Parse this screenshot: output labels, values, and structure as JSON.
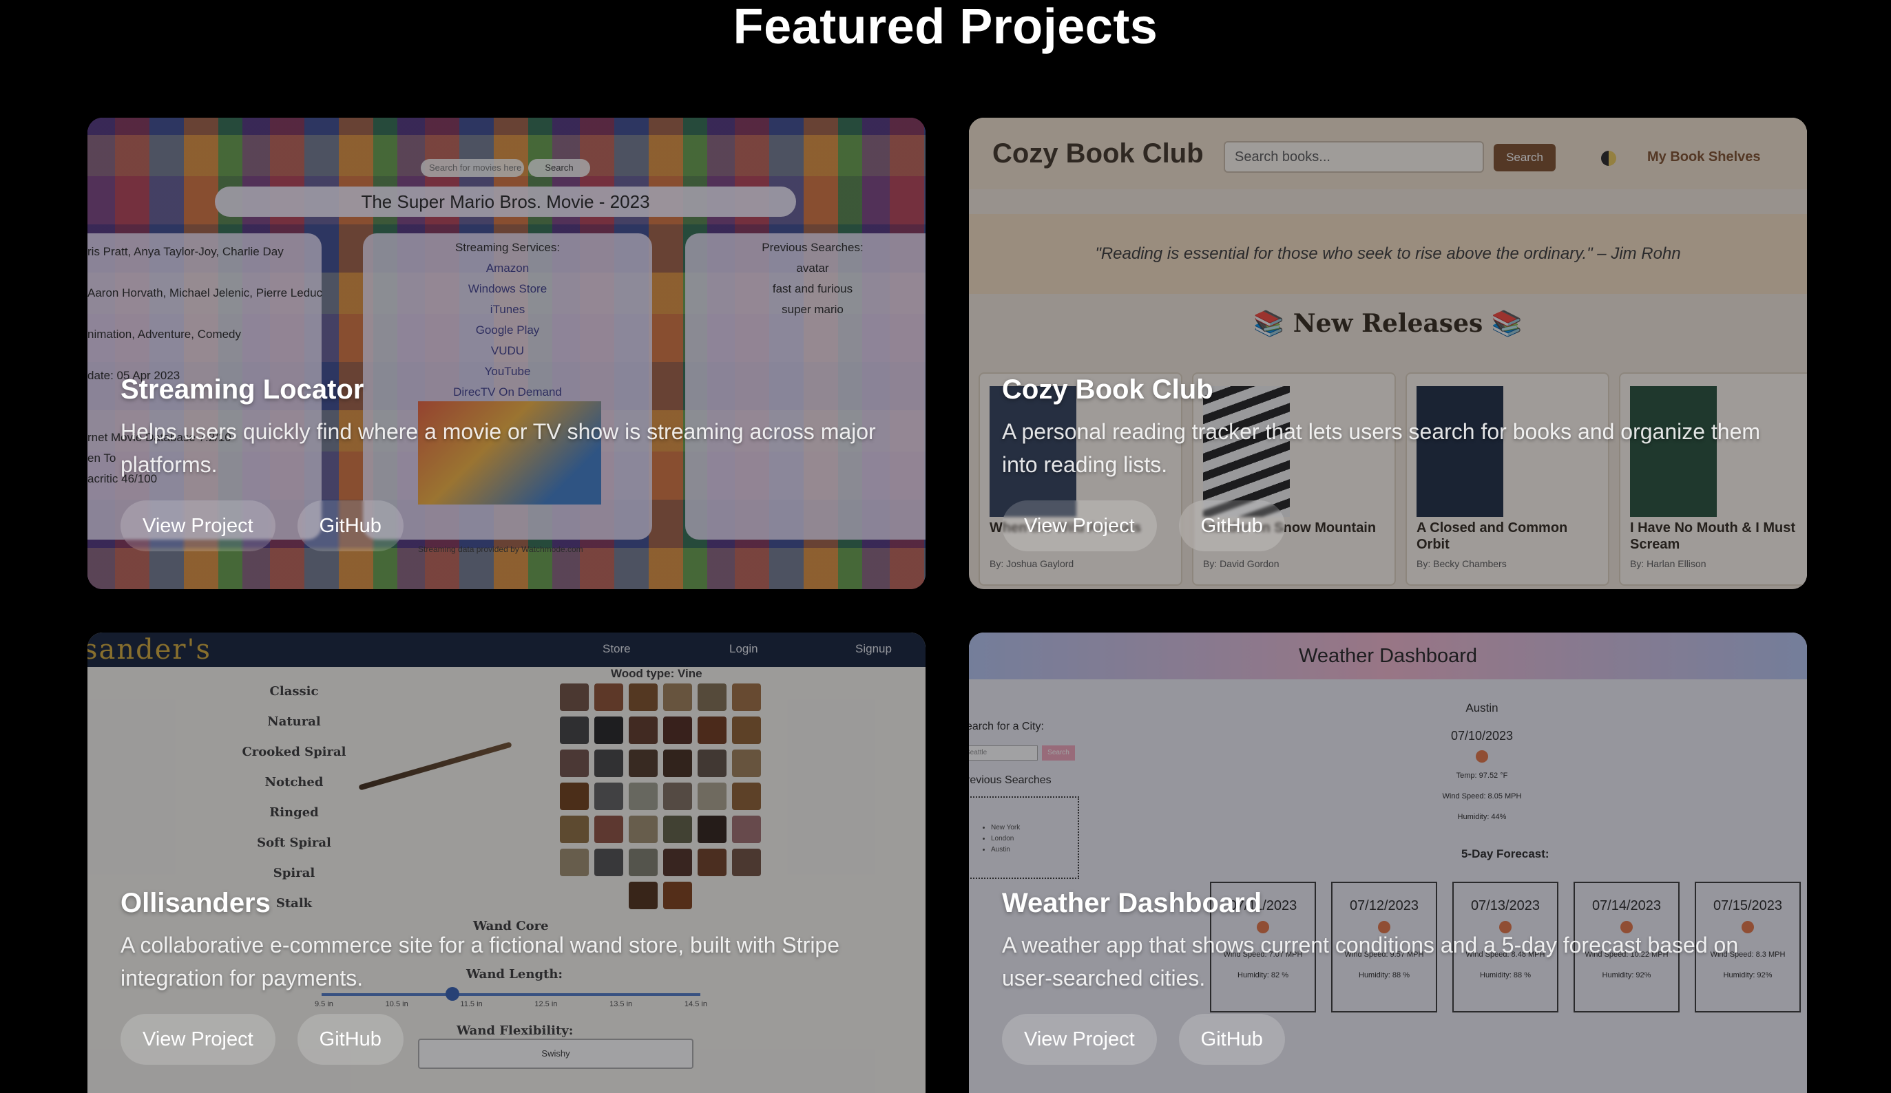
{
  "section_title": "Featured Projects",
  "projects": [
    {
      "title": "Streaming Locator",
      "description": "Helps users quickly find where a movie or TV show is streaming across major platforms.",
      "view_label": "View Project",
      "github_label": "GitHub"
    },
    {
      "title": "Cozy Book Club",
      "description": "A personal reading tracker that lets users search for books and organize them into reading lists.",
      "view_label": "View Project",
      "github_label": "GitHub"
    },
    {
      "title": "Ollisanders",
      "description": "A collaborative e-commerce site for a fictional wand store, built with Stripe integration for payments.",
      "view_label": "View Project",
      "github_label": "GitHub"
    },
    {
      "title": "Weather Dashboard",
      "description": "A weather app that shows current conditions and a 5-day forecast based on user-searched cities.",
      "view_label": "View Project",
      "github_label": "GitHub"
    }
  ],
  "streaming_shot": {
    "search_placeholder": "Search for movies here",
    "search_button": "Search",
    "movie_title": "The Super Mario Bros. Movie - 2023",
    "details": [
      "ris Pratt, Anya Taylor-Joy, Charlie Day",
      "Aaron Horvath, Michael Jelenic, Pierre Leduc",
      "nimation, Adventure, Comedy",
      "date: 05 Apr 2023",
      "rnet Movie Database 7.2/10",
      "en To",
      "acritic 46/100"
    ],
    "services_heading": "Streaming Services:",
    "services": [
      "Amazon",
      "Windows Store",
      "iTunes",
      "Google Play",
      "VUDU",
      "YouTube",
      "DirecTV On Demand"
    ],
    "previous_heading": "Previous Searches:",
    "previous": [
      "avatar",
      "fast and furious",
      "super mario"
    ],
    "credit": "Streaming data provided by Watchmode.com"
  },
  "book_shot": {
    "brand": "Cozy Book Club",
    "search_placeholder": "Search books...",
    "search_button": "Search",
    "shelves_link": "My Book Shelves",
    "quote": "\"Reading is essential for those who seek to rise above the ordinary.\" – Jim Rohn",
    "section_heading": "📚 New Releases 📚",
    "books": [
      {
        "title": "When the Wild Animals",
        "author": "By: Joshua Gaylord",
        "cover": "#2b3c56"
      },
      {
        "title": "Murder on Snow Mountain",
        "author": "By: David Gordon",
        "cover": "#e6e6e6"
      },
      {
        "title": "A Closed and Common Orbit",
        "author": "By: Becky Chambers",
        "cover": "#17263f"
      },
      {
        "title": "I Have No Mouth & I Must Scream",
        "author": "By: Harlan Ellison",
        "cover": "#1f4a35"
      }
    ]
  },
  "wand_shot": {
    "brand": "sander's",
    "nav": [
      "Store",
      "Login",
      "Signup"
    ],
    "wood_type": "Wood type: Vine",
    "types": [
      "Classic",
      "Natural",
      "Crooked Spiral",
      "Notched",
      "Ringed",
      "Soft Spiral",
      "Spiral",
      "Stalk"
    ],
    "swatches": [
      "#6b4a3b",
      "#8a4a2c",
      "#7a4a22",
      "#9b7b52",
      "#7d6a4a",
      "#9b6a3b",
      "#3b3b3b",
      "#1e1e1e",
      "#5a3222",
      "#4a2418",
      "#6b3216",
      "#8a5a2a",
      "#6b4a42",
      "#3e3e3e",
      "#4a3222",
      "#3e2618",
      "#5a4a3e",
      "#9b7b52",
      "#6b3a12",
      "#5a5a5a",
      "#9b9b8a",
      "#7a6a5a",
      "#a9a08b",
      "#8a5a2c",
      "#8a6a3a",
      "#8a4a3a",
      "#9b8a6a",
      "#5a5a3e",
      "#2a1a12",
      "#9b6a6a",
      "#9b8a6a",
      "#4a4a4a",
      "#7a7a6a",
      "#4a2a1e",
      "#6b3a1e",
      "#6b4a3a",
      "#4a2a12",
      "#7a3a12"
    ],
    "core_label": "Wand Core",
    "length_label": "Wand Length:",
    "length_ticks": [
      "9.5 in",
      "10.5 in",
      "11.5 in",
      "12.5 in",
      "13.5 in",
      "14.5 in"
    ],
    "length_value": 0.38,
    "flex_label": "Wand Flexibility:",
    "flex_value": "Swishy"
  },
  "weather_shot": {
    "header": "Weather Dashboard",
    "search_label": "earch for a City:",
    "search_placeholder": "Seattle",
    "search_button": "Search",
    "previous_label": "revious Searches",
    "previous": [
      "New York",
      "London",
      "Austin"
    ],
    "city": "Austin",
    "date": "07/10/2023",
    "temp": "Temp: 97.52 °F",
    "wind": "Wind Speed: 8.05 MPH",
    "humidity": "Humidity: 44%",
    "forecast_label": "5-Day Forecast:",
    "days": [
      {
        "date": "07/11/2023",
        "wind": "Wind Speed: 7.07 MPH",
        "humidity": "Humidity: 82 %"
      },
      {
        "date": "07/12/2023",
        "wind": "Wind Speed: 9.57 MPH",
        "humidity": "Humidity: 88 %"
      },
      {
        "date": "07/13/2023",
        "wind": "Wind Speed: 8.48 MPH",
        "humidity": "Humidity: 88 %"
      },
      {
        "date": "07/14/2023",
        "wind": "Wind Speed: 10.22 MPH",
        "humidity": "Humidity: 92%"
      },
      {
        "date": "07/15/2023",
        "wind": "Wind Speed: 8.3 MPH",
        "humidity": "Humidity: 92%"
      }
    ]
  }
}
